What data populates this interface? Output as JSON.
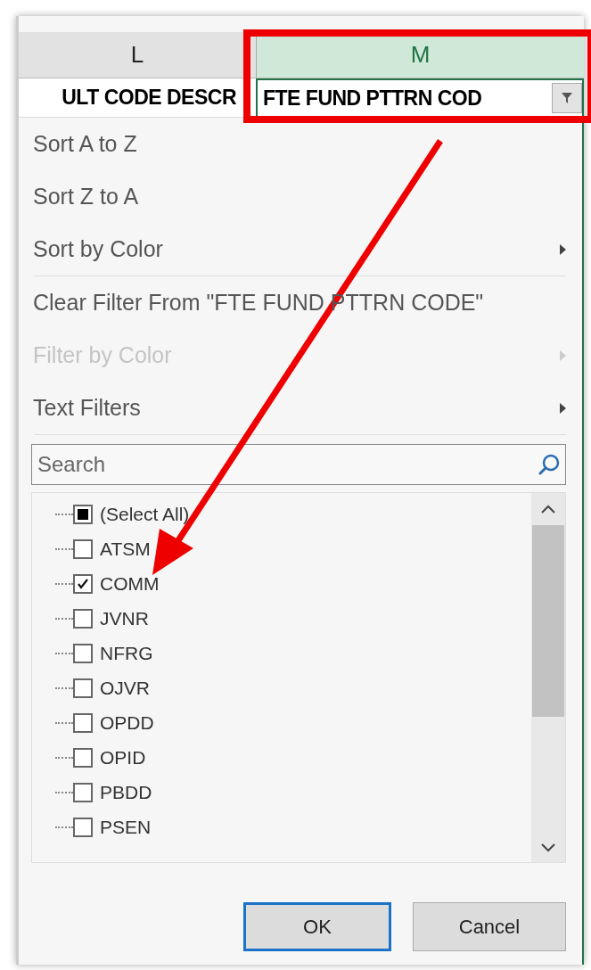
{
  "columns": [
    {
      "letter": "L",
      "header": "ULT CODE DESCR",
      "selected": false
    },
    {
      "letter": "M",
      "header": "FTE FUND PTTRN COD",
      "selected": true
    }
  ],
  "menu": [
    {
      "kind": "item",
      "label": "Sort A to Z",
      "disabled": false,
      "submenu": false
    },
    {
      "kind": "item",
      "label": "Sort Z to A",
      "disabled": false,
      "submenu": false
    },
    {
      "kind": "item",
      "label": "Sort by Color",
      "disabled": false,
      "submenu": true
    },
    {
      "kind": "separator"
    },
    {
      "kind": "item",
      "label": "Clear Filter From \"FTE FUND PTTRN CODE\"",
      "disabled": false,
      "submenu": false
    },
    {
      "kind": "item",
      "label": "Filter by Color",
      "disabled": true,
      "submenu": true
    },
    {
      "kind": "item",
      "label": "Text Filters",
      "disabled": false,
      "submenu": true
    },
    {
      "kind": "separator"
    }
  ],
  "search": {
    "placeholder": "Search"
  },
  "values": [
    {
      "label": "(Select All)",
      "checked": false,
      "partial": true
    },
    {
      "label": "ATSM",
      "checked": false,
      "partial": false
    },
    {
      "label": "COMM",
      "checked": true,
      "partial": false
    },
    {
      "label": "JVNR",
      "checked": false,
      "partial": false
    },
    {
      "label": "NFRG",
      "checked": false,
      "partial": false
    },
    {
      "label": "OJVR",
      "checked": false,
      "partial": false
    },
    {
      "label": "OPDD",
      "checked": false,
      "partial": false
    },
    {
      "label": "OPID",
      "checked": false,
      "partial": false
    },
    {
      "label": "PBDD",
      "checked": false,
      "partial": false
    },
    {
      "label": "PSEN",
      "checked": false,
      "partial": false
    }
  ],
  "buttons": [
    {
      "label": "OK",
      "default": true
    },
    {
      "label": "Cancel",
      "default": false
    }
  ]
}
